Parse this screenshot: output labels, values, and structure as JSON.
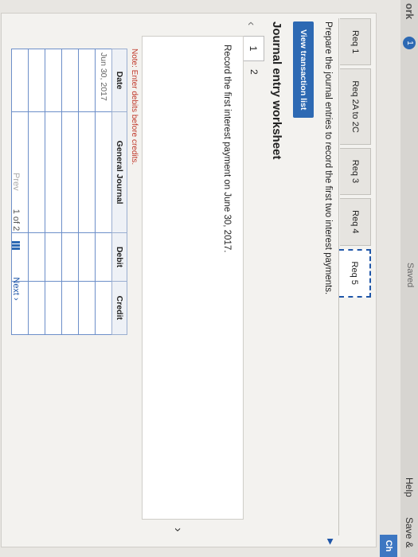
{
  "header": {
    "work_label": "ork",
    "badge": "1",
    "saved_label": "Saved",
    "help_label": "Help",
    "save_exit_label": "Save &",
    "check_label": "Ch"
  },
  "tabs": [
    {
      "label": "Req 1"
    },
    {
      "label": "Req 2A to 2C"
    },
    {
      "label": "Req 3"
    },
    {
      "label": "Req 4"
    },
    {
      "label": "Req 5",
      "active": true
    }
  ],
  "instruction": "Prepare the journal entries to record the first two interest payments.",
  "view_button": "View transaction list",
  "worksheet": {
    "title": "Journal entry worksheet",
    "current_page": "1",
    "next_page": "2",
    "prompt": "Record the first interest payment on June 30, 2017."
  },
  "note": "Note: Enter debits before credits.",
  "table": {
    "headers": [
      "Date",
      "General Journal",
      "Debit",
      "Credit"
    ],
    "rows": [
      [
        "Jun 30, 2017",
        "",
        "",
        ""
      ],
      [
        "",
        "",
        "",
        ""
      ],
      [
        "",
        "",
        "",
        ""
      ],
      [
        "",
        "",
        "",
        ""
      ],
      [
        "",
        "",
        "",
        ""
      ],
      [
        "",
        "",
        "",
        ""
      ]
    ]
  },
  "pager": {
    "prev": "Prev",
    "current": "1",
    "of": "of",
    "total": "2",
    "next": "Next"
  },
  "colors": {
    "accent": "#2d69b3",
    "note": "#c0392b"
  }
}
